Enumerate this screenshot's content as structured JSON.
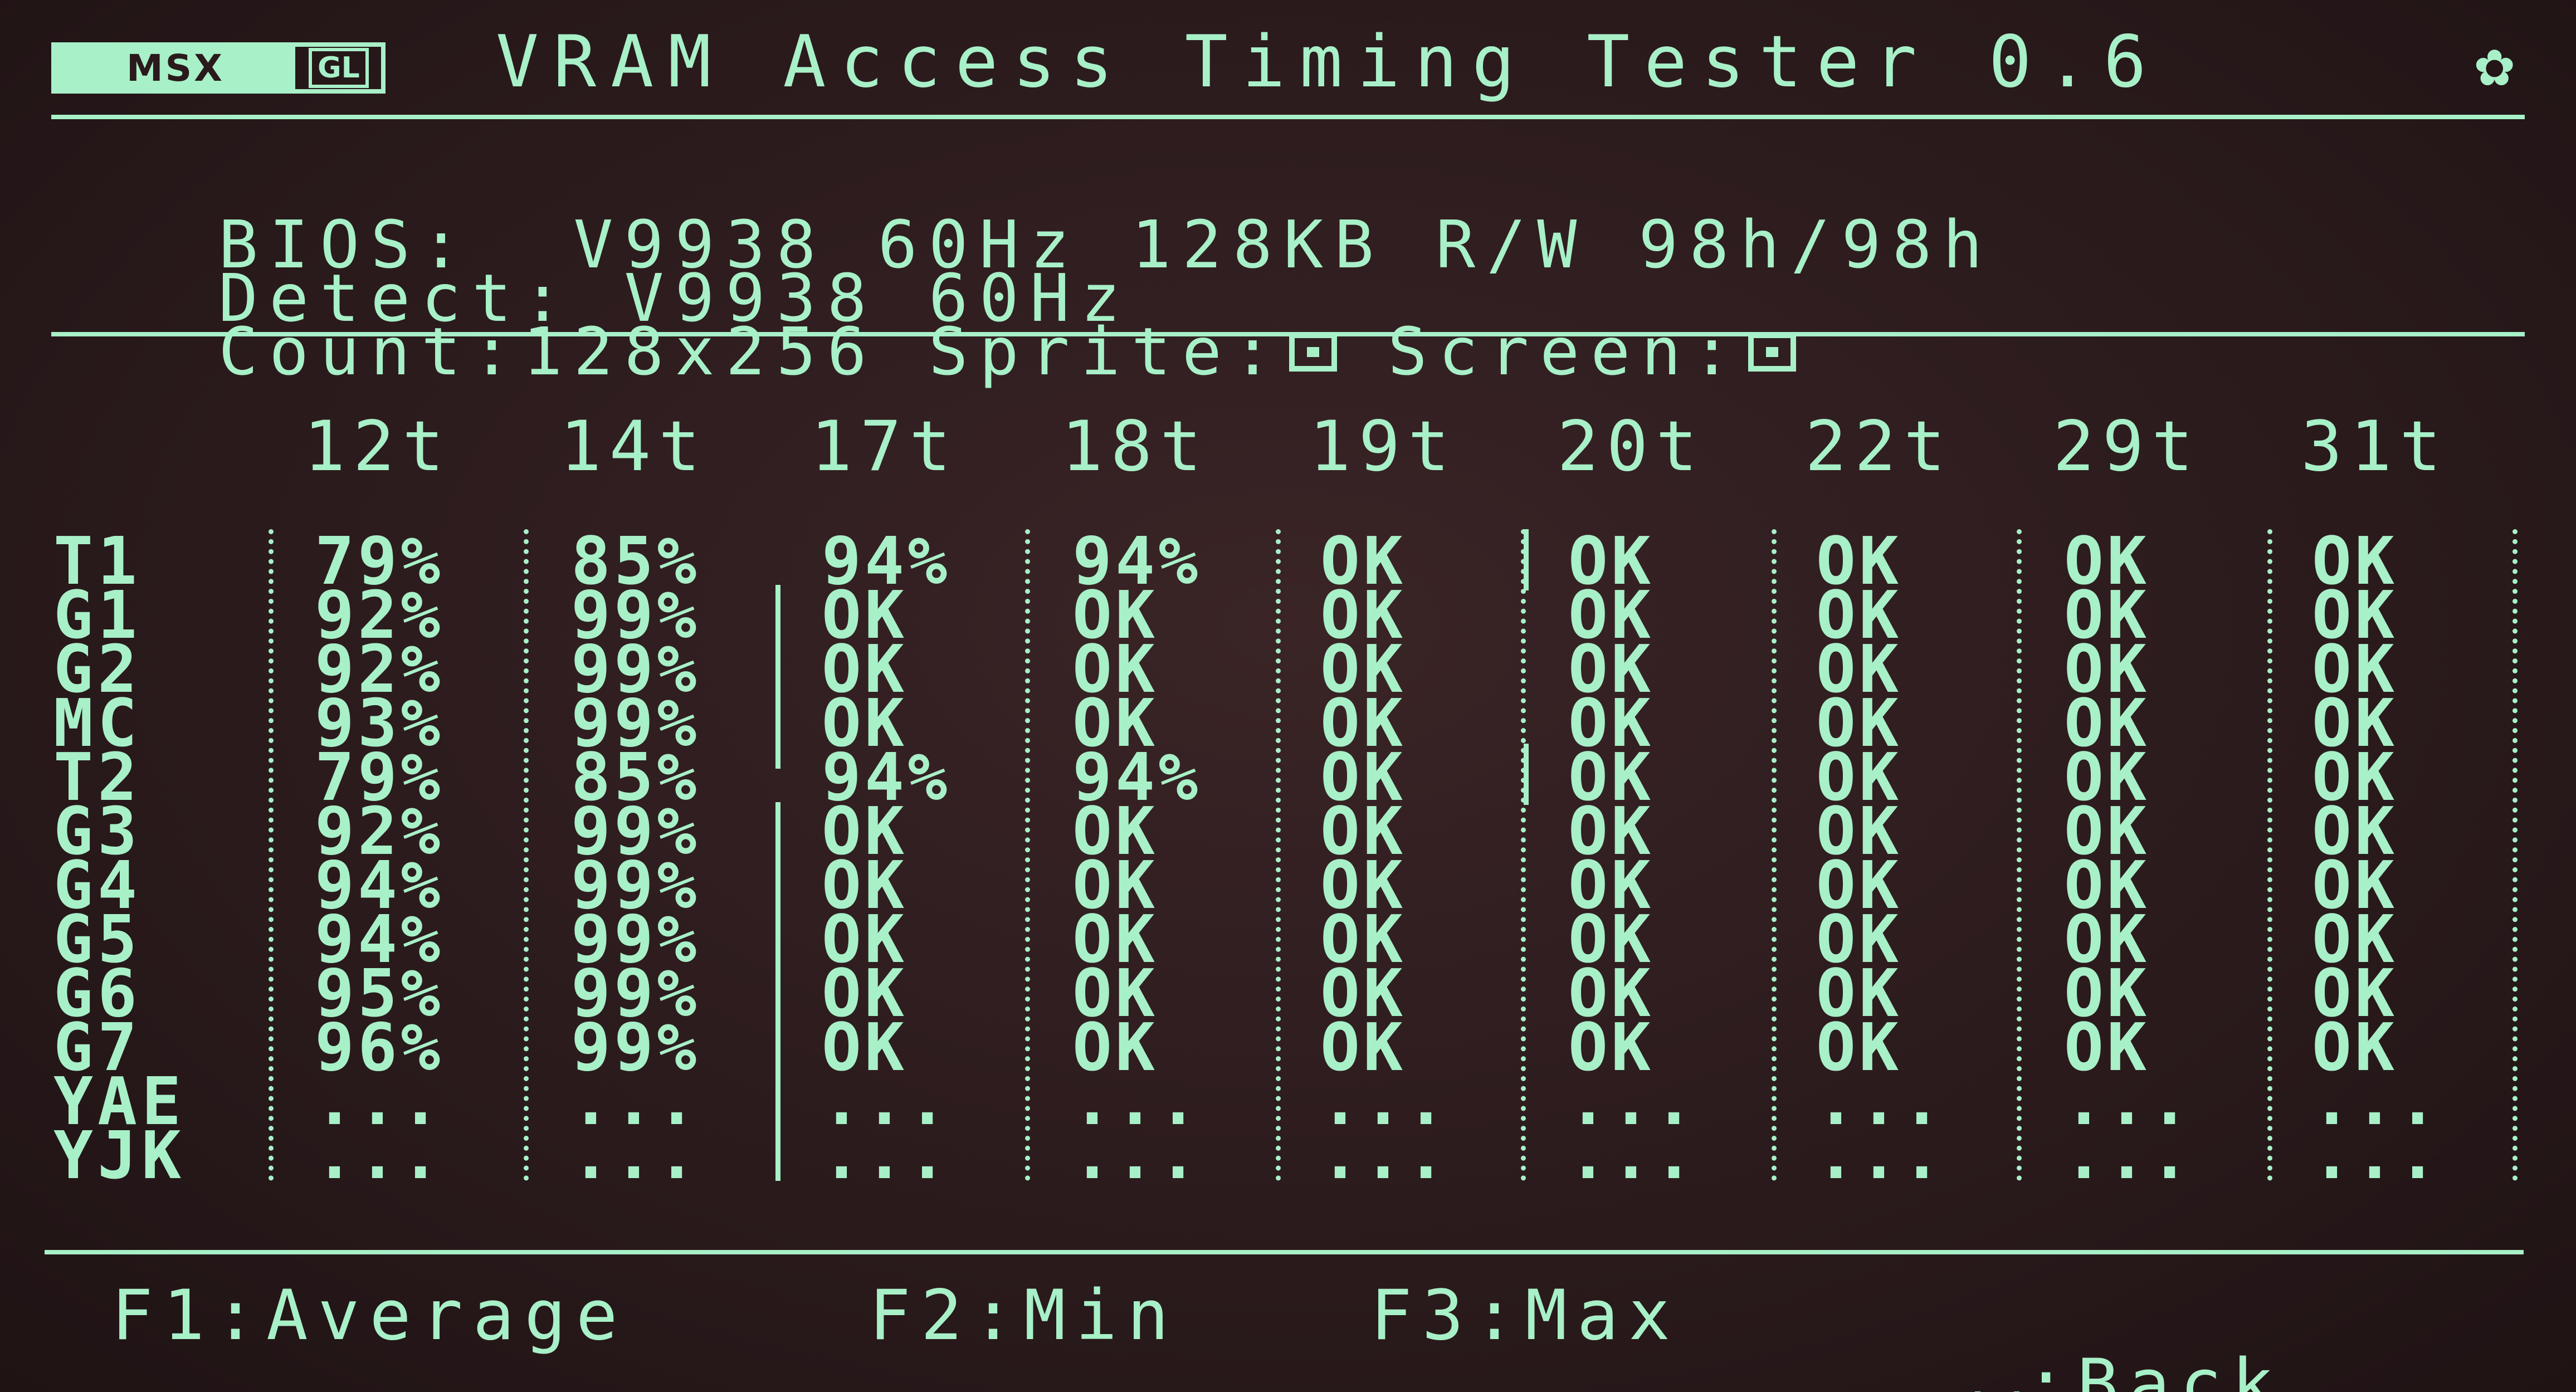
{
  "header": {
    "logo_main": "MSX",
    "logo_sub": "GL",
    "title": "VRAM Access Timing Tester 0.6",
    "settings_icon": "gear-icon"
  },
  "info": {
    "bios_label": "BIOS:",
    "bios_value": "V9938 60Hz 128KB R/W 98h/98h",
    "detect_label": "Detect:",
    "detect_value": "V9938 60Hz",
    "count_label": "Count:",
    "count_value": "128x256",
    "sprite_label": "Sprite:",
    "screen_label": "Screen:"
  },
  "table": {
    "columns": [
      "12t",
      "14t",
      "17t",
      "18t",
      "19t",
      "20t",
      "22t",
      "29t",
      "31t"
    ],
    "rows": [
      {
        "label": "T1",
        "values": [
          "79%",
          "85%",
          "94%",
          "94%",
          "OK",
          "OK",
          "OK",
          "OK",
          "OK"
        ]
      },
      {
        "label": "G1",
        "values": [
          "92%",
          "99%",
          "OK",
          "OK",
          "OK",
          "OK",
          "OK",
          "OK",
          "OK"
        ]
      },
      {
        "label": "G2",
        "values": [
          "92%",
          "99%",
          "OK",
          "OK",
          "OK",
          "OK",
          "OK",
          "OK",
          "OK"
        ]
      },
      {
        "label": "MC",
        "values": [
          "93%",
          "99%",
          "OK",
          "OK",
          "OK",
          "OK",
          "OK",
          "OK",
          "OK"
        ]
      },
      {
        "label": "T2",
        "values": [
          "79%",
          "85%",
          "94%",
          "94%",
          "OK",
          "OK",
          "OK",
          "OK",
          "OK"
        ]
      },
      {
        "label": "G3",
        "values": [
          "92%",
          "99%",
          "OK",
          "OK",
          "OK",
          "OK",
          "OK",
          "OK",
          "OK"
        ]
      },
      {
        "label": "G4",
        "values": [
          "94%",
          "99%",
          "OK",
          "OK",
          "OK",
          "OK",
          "OK",
          "OK",
          "OK"
        ]
      },
      {
        "label": "G5",
        "values": [
          "94%",
          "99%",
          "OK",
          "OK",
          "OK",
          "OK",
          "OK",
          "OK",
          "OK"
        ]
      },
      {
        "label": "G6",
        "values": [
          "95%",
          "99%",
          "OK",
          "OK",
          "OK",
          "OK",
          "OK",
          "OK",
          "OK"
        ]
      },
      {
        "label": "G7",
        "values": [
          "96%",
          "99%",
          "OK",
          "OK",
          "OK",
          "OK",
          "OK",
          "OK",
          "OK"
        ]
      },
      {
        "label": "YAE",
        "values": [
          "...",
          "...",
          "...",
          "...",
          "...",
          "...",
          "...",
          "...",
          "..."
        ]
      },
      {
        "label": "YJK",
        "values": [
          "...",
          "...",
          "...",
          "...",
          "...",
          "...",
          "...",
          "...",
          "..."
        ]
      }
    ]
  },
  "footer": {
    "f1": "F1:Average",
    "f2": "F2:Min",
    "f3": "F3:Max",
    "space": ":Back"
  },
  "colors": {
    "foreground": "#a8f0c8",
    "background": "#2b1a1c"
  }
}
